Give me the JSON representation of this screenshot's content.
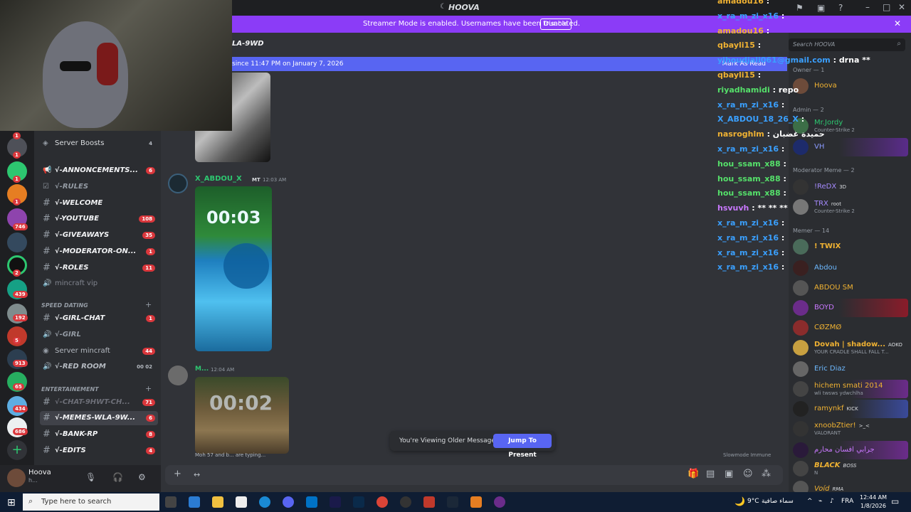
{
  "titlebar": {
    "title": "HOOVA"
  },
  "banner": {
    "text": "Streamer Mode is enabled. Usernames have been truncated.",
    "button": "Disable"
  },
  "header": {
    "channel": "LA-9WD"
  },
  "new_messages": {
    "text": "since 11:47 PM on January 7, 2026",
    "mark": "Mark As Read"
  },
  "server_rail": {
    "badges": [
      "1",
      "1",
      "1",
      "1",
      "746",
      "2",
      "439",
      "192",
      "5",
      "913",
      "65",
      "434",
      "686"
    ]
  },
  "channels": {
    "items": [
      {
        "label": "Server Boosts",
        "badge": "4",
        "style": "normal"
      },
      {
        "label": "√-ANNONCEMENTS...",
        "badge": "6"
      },
      {
        "label": "√-RULES",
        "badge": "",
        "muted": true
      },
      {
        "label": "√-WELCOME",
        "badge": ""
      },
      {
        "label": "√-YOUTUBE",
        "badge": "108"
      },
      {
        "label": "√-GIVEAWAYS",
        "badge": "35"
      },
      {
        "label": "√-MODERATOR-ON...",
        "badge": "1"
      },
      {
        "label": "√-ROLES",
        "badge": "11"
      },
      {
        "label": "mincraft vip",
        "badge": ""
      },
      {
        "label": "√-GIRL-CHAT",
        "badge": "1"
      },
      {
        "label": "√-GIRL",
        "badge": ""
      },
      {
        "label": "Server mincraft",
        "badge": "44"
      },
      {
        "label": "√-RED ROOM",
        "badge": "00 02"
      },
      {
        "label": "√-CHAT-9HWT-CH...",
        "badge": "71"
      },
      {
        "label": "√-MEMES-WLA-9W...",
        "badge": "6"
      },
      {
        "label": "√-BANK-RP",
        "badge": "8"
      },
      {
        "label": "√-EDITS",
        "badge": "4"
      }
    ],
    "categories": [
      "SPEED DATING",
      "ENTERTAINEMENT"
    ]
  },
  "user": {
    "name": "Hoova",
    "status": "h..."
  },
  "messages": [
    {
      "author": "X_ABDOU_X",
      "tag": "MT",
      "time": "12:03 AM"
    },
    {
      "author": "M...",
      "time": "12:04 AM"
    }
  ],
  "media_text": {
    "clock1": "00:03",
    "clock2": "00:02"
  },
  "typing": "Moh 57 and b... are typing...",
  "slowmode": "Slowmode Immune",
  "older": {
    "text": "You're Viewing Older Messages",
    "button": "Jump To Present"
  },
  "overlay_chat": [
    {
      "name": "amadou16",
      "text": "",
      "color": "#f0b232"
    },
    {
      "name": "x_ra_m_zi_x16",
      "text": "",
      "color": "#3aa0ff"
    },
    {
      "name": "amadou16",
      "text": "",
      "color": "#f0b232"
    },
    {
      "name": "qbayli15",
      "text": "",
      "color": "#f0b232"
    },
    {
      "name": "yjhoudjali061@gmail.com",
      "text": "drna **",
      "color": "#3aa0ff"
    },
    {
      "name": "qbayli15",
      "text": "",
      "color": "#f0b232"
    },
    {
      "name": "riyadhamidi",
      "text": "repo",
      "color": "#55e06a"
    },
    {
      "name": "x_ra_m_zi_x16",
      "text": "",
      "color": "#3aa0ff"
    },
    {
      "name": "X_ABDOU_18_26_X",
      "text": "",
      "color": "#3aa0ff"
    },
    {
      "name": "nasroghlm",
      "text": "حميدة غضبان",
      "color": "#f0b232"
    },
    {
      "name": "x_ra_m_zi_x16",
      "text": "",
      "color": "#3aa0ff"
    },
    {
      "name": "hou_ssam_x88",
      "text": "",
      "color": "#55e06a"
    },
    {
      "name": "hou_ssam_x88",
      "text": "",
      "color": "#55e06a"
    },
    {
      "name": "hou_ssam_x88",
      "text": "",
      "color": "#55e06a"
    },
    {
      "name": "hsvuvh",
      "text": "** ** **",
      "color": "#c978ff"
    },
    {
      "name": "x_ra_m_zi_x16",
      "text": "",
      "color": "#3aa0ff"
    },
    {
      "name": "x_ra_m_zi_x16",
      "text": "",
      "color": "#3aa0ff"
    },
    {
      "name": "x_ra_m_zi_x16",
      "text": "",
      "color": "#3aa0ff"
    },
    {
      "name": "x_ra_m_zi_x16",
      "text": "",
      "color": "#3aa0ff"
    }
  ],
  "members": {
    "search_placeholder": "Search HOOVA",
    "groups": [
      {
        "label": "Owner — 1",
        "items": [
          {
            "name": "Hoova",
            "color": "#f0b232",
            "sub": ""
          }
        ]
      },
      {
        "label": "Admin — 2",
        "items": [
          {
            "name": "Mr.Jordy",
            "color": "#2dc770",
            "sub": "Counter-Strike 2"
          },
          {
            "name": "VH",
            "color": "#8b9bff",
            "sub": ""
          }
        ]
      },
      {
        "label": "Moderator Meme — 2",
        "items": [
          {
            "name": "!ReDX",
            "color": "#a68bff",
            "sub": "",
            "tag": "3D"
          },
          {
            "name": "TRX",
            "color": "#a68bff",
            "sub": "Counter-Strike 2",
            "tag": "root"
          }
        ]
      },
      {
        "label": "Memer — 14",
        "items": [
          {
            "name": "! TWIX",
            "color": "#f0b232",
            "sub": ""
          },
          {
            "name": "Abdou",
            "color": "#6db9ff",
            "sub": ""
          },
          {
            "name": "ABDOU SM",
            "color": "#f0b232",
            "sub": ""
          },
          {
            "name": "BOYD",
            "color": "#c978ff",
            "sub": ""
          },
          {
            "name": "CØZMØ",
            "color": "#f0b232",
            "sub": ""
          },
          {
            "name": "Dovah | shadow...",
            "color": "#f0b232",
            "sub": "YOUR CRADLE SHALL FALL T...",
            "tag": "AOKO"
          },
          {
            "name": "Eric Diaz",
            "color": "#6db9ff",
            "sub": ""
          },
          {
            "name": "hichem smati 2014",
            "color": "#f0b232",
            "sub": "wli twsws ydwchlha"
          },
          {
            "name": "ramynkf",
            "color": "#f0b232",
            "sub": "",
            "tag": "KICK"
          },
          {
            "name": "xnoobZtier!",
            "color": "#f0b232",
            "sub": "VALORANT",
            "tag": ">_<"
          },
          {
            "name": "جرابي افسان محارم",
            "color": "#c978ff",
            "sub": ""
          },
          {
            "name": "BLACK",
            "color": "#f0b232",
            "sub": "N",
            "tag": "BOSS"
          },
          {
            "name": "Voíd",
            "color": "#f0b232",
            "sub": "",
            "tag": "RMA"
          }
        ]
      }
    ]
  },
  "taskbar": {
    "search_placeholder": "Type here to search",
    "weather": "9°C",
    "weather_text": "سماء صافية",
    "lang": "FRA",
    "time": "12:44 AM",
    "date": "1/8/2026"
  }
}
